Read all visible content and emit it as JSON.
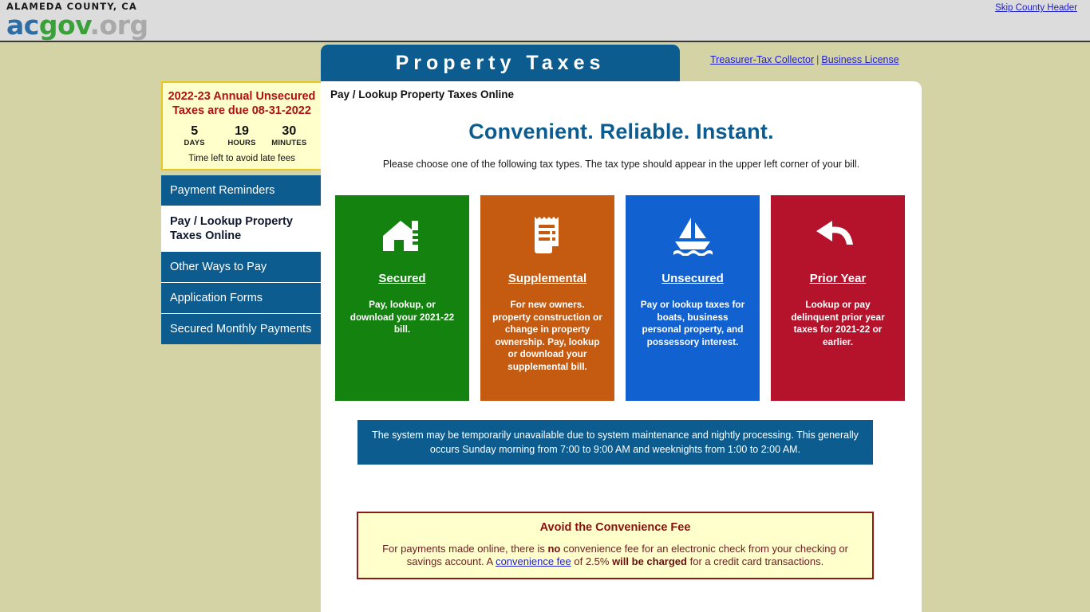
{
  "header": {
    "county_line": "ALAMEDA COUNTY, CA",
    "logo_ac": "ac",
    "logo_gov": "gov",
    "logo_org": ".org",
    "skip_link": "Skip County Header"
  },
  "banner": {
    "title": "Property Taxes",
    "links": [
      {
        "label": "Treasurer-Tax Collector"
      },
      {
        "label": "Business License"
      }
    ],
    "link_divider": "|"
  },
  "sidebar": {
    "countdown": {
      "title": "2022-23 Annual Unsecured Taxes are due 08-31-2022",
      "units": [
        {
          "value": "5",
          "label": "DAYS"
        },
        {
          "value": "19",
          "label": "HOURS"
        },
        {
          "value": "30",
          "label": "MINUTES"
        }
      ],
      "footnote": "Time left to avoid late fees"
    },
    "nav": [
      {
        "label": "Payment Reminders",
        "active": false
      },
      {
        "label": "Pay / Lookup Property Taxes Online",
        "active": true
      },
      {
        "label": "Other Ways to Pay",
        "active": false
      },
      {
        "label": "Application Forms",
        "active": false
      },
      {
        "label": "Secured Monthly Payments",
        "active": false
      }
    ]
  },
  "main": {
    "breadcrumb": "Pay / Lookup Property Taxes Online",
    "tagline": "Convenient. Reliable. Instant.",
    "instructions": "Please choose one of the following tax types. The tax type should appear in the upper left corner of your bill.",
    "cards": [
      {
        "title": "Secured",
        "description": "Pay, lookup, or download your 2021-22 bill.",
        "color": "#13820f",
        "icon": "house-icon"
      },
      {
        "title": "Supplemental",
        "description": "For new owners. property construction or change in property ownership. Pay, lookup or download your supplemental bill.",
        "color": "#c55a11",
        "icon": "receipt-icon"
      },
      {
        "title": "Unsecured",
        "description": "Pay or lookup taxes for boats, business personal property, and possessory interest.",
        "color": "#1161d0",
        "icon": "sailboat-icon"
      },
      {
        "title": "Prior Year",
        "description": "Lookup or pay delinquent prior year taxes for 2021-22 or earlier.",
        "color": "#b5122b",
        "icon": "undo-arrow-icon"
      }
    ],
    "maintenance_notice": "The system may be temporarily unavailable due to system maintenance and nightly processing. This generally occurs Sunday morning from 7:00 to 9:00 AM and weeknights from 1:00 to 2:00 AM.",
    "fee_box": {
      "title": "Avoid the Convenience Fee",
      "text_1": "For payments made online, there is ",
      "bold_1": "no",
      "text_2": " convenience fee for an electronic check from your checking or savings account. A ",
      "link": "convenience fee",
      "text_3": " of 2.5% ",
      "bold_2": "will be charged",
      "text_4": " for a credit card transactions."
    }
  },
  "colors": {
    "page_background": "#d4d3a6",
    "brand_blue": "#0c5c8f",
    "link_blue": "#2020cc",
    "alert_red": "#b01010",
    "countdown_yellow": "#ffffcc"
  }
}
